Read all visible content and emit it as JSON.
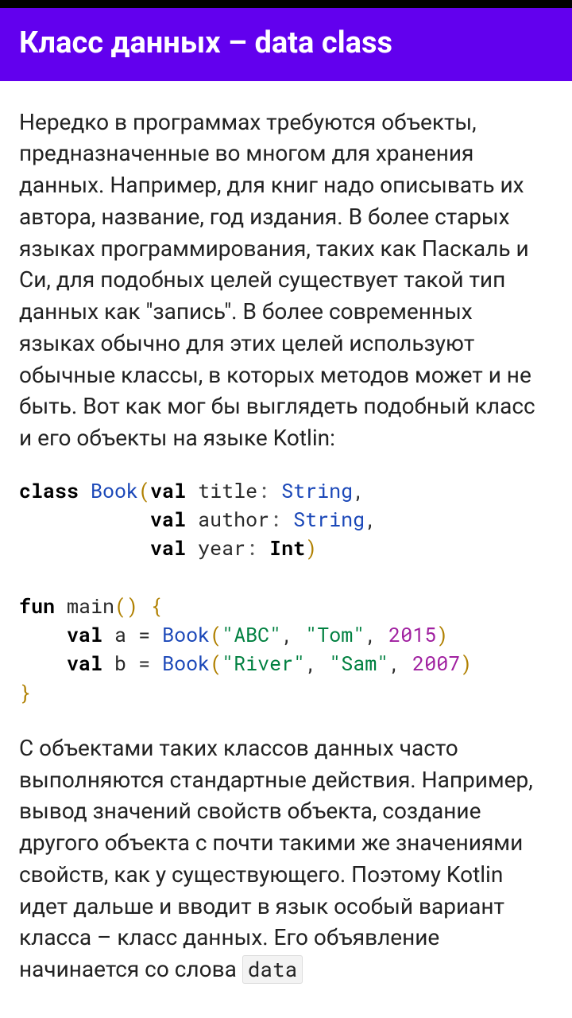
{
  "header": {
    "title": "Класс данных – data class"
  },
  "paragraph1": "Нередко в программах требуются объекты, предназначенные во многом для хранения данных. Например, для книг надо описывать их автора, название, год издания. В более старых языках программирования, таких как Паскаль и Си, для подобных целей существует такой тип данных как \"запись\". В более современных языках обычно для этих целей используют обычные классы, в которых методов может и не быть. Вот как мог бы выглядеть подобный класс и его объекты на языке Kotlin:",
  "code": {
    "kw_class": "class",
    "cls_book": "Book",
    "kw_val": "val",
    "p_title": "title",
    "t_string": "String",
    "p_author": "author",
    "p_year": "year",
    "t_int": "Int",
    "kw_fun": "fun",
    "fn_main": "main",
    "v_a": "a",
    "v_b": "b",
    "s_abc": "\"ABC\"",
    "s_tom": "\"Tom\"",
    "n_2015": "2015",
    "s_river": "\"River\"",
    "s_sam": "\"Sam\"",
    "n_2007": "2007"
  },
  "paragraph2_part1": "С объектами таких классов данных часто выполняются стандартные действия. Например, вывод значений свойств объекта, создание другого объекта с почти такими же значениями свойств, как у существующего. Поэтому Kotlin идет дальше и вводит в язык особый вариант класса – класс данных. Его объявление начинается со слова ",
  "paragraph2_code": "data"
}
